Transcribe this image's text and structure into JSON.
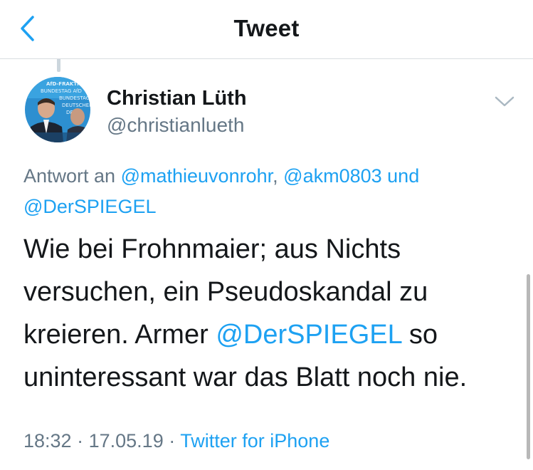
{
  "header": {
    "title": "Tweet"
  },
  "tweet": {
    "author_name": "Christian Lüth",
    "author_handle": "@christianlueth",
    "reply_prefix": "Antwort an",
    "reply_to": [
      "@mathieuvonrohr",
      "@akm0803",
      "@DerSPIEGEL"
    ],
    "reply_sep": ",",
    "reply_and": "und",
    "text_part1": "Wie bei Frohnmaier; aus Nichts versuchen, ein Pseudoskandal zu kreieren. Armer",
    "text_mention": "@DerSPIEGEL",
    "text_part2": "so uninteressant war das Blatt noch nie.",
    "time": "18:32",
    "dot": "·",
    "date": "17.05.19",
    "source": "Twitter for iPhone"
  },
  "avatar_text": [
    "AfD-FRAKTION",
    "BUNDESTAG AfD",
    "BUNDESTAG",
    "DEUTSCHEN",
    "DE"
  ],
  "colors": {
    "accent": "#1da1f2",
    "secondary_text": "#657786",
    "primary_text": "#14171a",
    "divider": "#d9dde1"
  },
  "icons": {
    "back": "chevron-left-icon",
    "menu": "chevron-down-icon"
  }
}
